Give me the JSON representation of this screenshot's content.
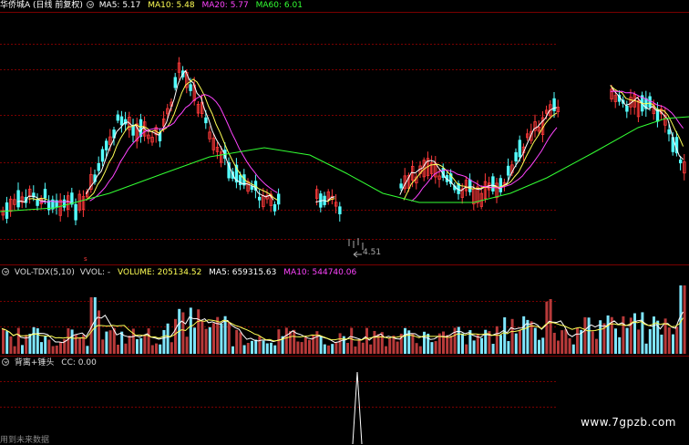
{
  "colors": {
    "background": "#000000",
    "grid": "#7a0000",
    "up": "#ff3a3a",
    "down": "#54ffff",
    "volume_up": "#b83a3a",
    "volume_down": "#7fe6ff",
    "ma5": "#ffffff",
    "ma10": "#ffff55",
    "ma20": "#ff44ff",
    "ma60": "#33ff33",
    "text": "#dddddd"
  },
  "main_legend": {
    "title": "华侨城A (日线 前复权)",
    "ma5": "MA5: 5.17",
    "ma10": "MA10: 5.48",
    "ma20": "MA20: 5.77",
    "ma60": "MA60: 6.01"
  },
  "low_marker": "4.51",
  "volume_legend": {
    "title": "VOL-TDX(5,10)",
    "vvol": "VVOL: -",
    "volume": "VOLUME: 205134.52",
    "ma5": "MA5: 659315.63",
    "ma10": "MA10: 544740.06"
  },
  "indicator_legend": {
    "title": "背离+锤头",
    "cc": "CC: 0.00"
  },
  "footer_note": "用到未来数据",
  "watermark": "www.7gpzb.com"
}
